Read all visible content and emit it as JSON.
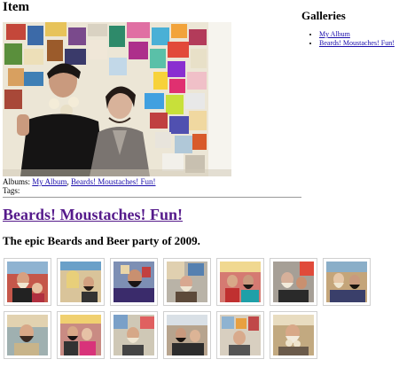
{
  "item": {
    "heading": "Item",
    "albums_label": "Albums:",
    "albums": [
      "My Album",
      "Beards! Moustaches! Fun!"
    ],
    "albums_separator": ", ",
    "tags_label": "Tags:"
  },
  "sidebar": {
    "heading": "Galleries",
    "links": [
      "My Album",
      "Beards! Moustaches! Fun!"
    ]
  },
  "gallery": {
    "title": "Beards! Moustaches! Fun!",
    "description": "The epic Beards and Beer party of 2009."
  },
  "thumbnails": {
    "count_row1": 7,
    "count_row2": 6
  }
}
